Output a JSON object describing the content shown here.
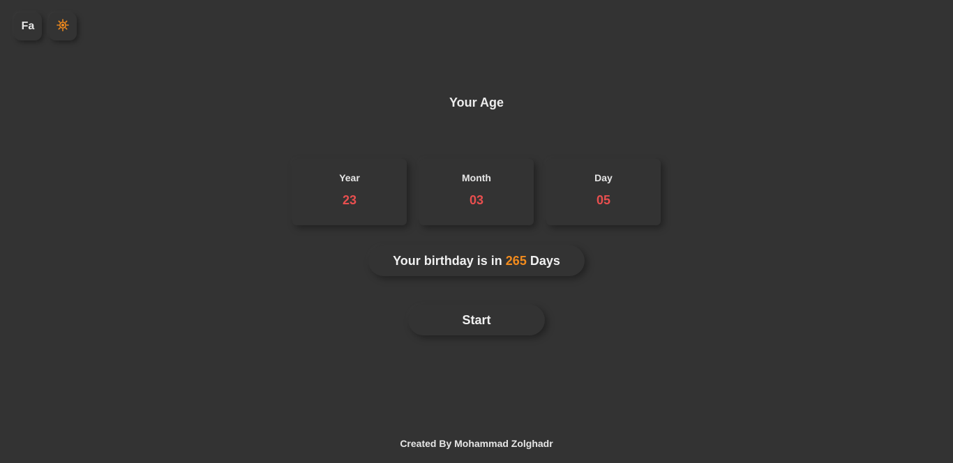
{
  "controls": {
    "lang_label": "Fa",
    "theme_icon": "sun-icon",
    "theme_icon_color": "#f28b1d"
  },
  "title": "Your Age",
  "age": {
    "year_label": "Year",
    "year_value": "23",
    "month_label": "Month",
    "month_value": "03",
    "day_label": "Day",
    "day_value": "05",
    "value_color": "#e94f4f"
  },
  "birthday": {
    "prefix": "Your birthday is in ",
    "days": "265",
    "suffix": " Days",
    "days_color": "#f28b1d"
  },
  "start_label": "Start",
  "footer": "Created By Mohammad Zolghadr"
}
